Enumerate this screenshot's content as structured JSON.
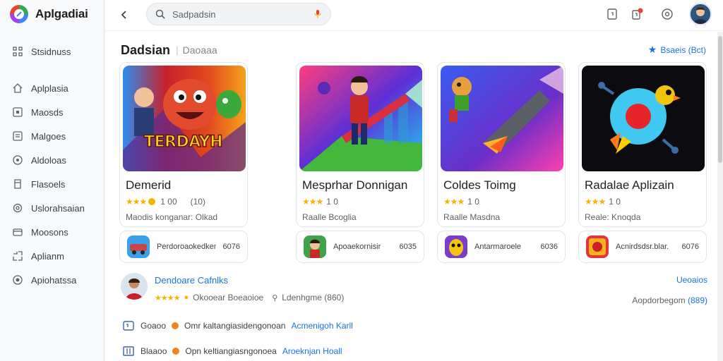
{
  "app": {
    "name": "Aplgadiai"
  },
  "sidebar": {
    "items": [
      {
        "label": "Stsidnuss",
        "icon": "grid-icon"
      },
      {
        "label": "Aplplasia",
        "icon": "home-icon"
      },
      {
        "label": "Maosds",
        "icon": "square-icon"
      },
      {
        "label": "Malgoes",
        "icon": "list-icon"
      },
      {
        "label": "Aldoloas",
        "icon": "badge-icon"
      },
      {
        "label": "Flasoels",
        "icon": "tag-icon"
      },
      {
        "label": "Uslorahsaian",
        "icon": "settings-icon"
      },
      {
        "label": "Moosons",
        "icon": "card-icon"
      },
      {
        "label": "Aplianm",
        "icon": "apps-icon"
      },
      {
        "label": "Apiohatssa",
        "icon": "info-icon"
      }
    ]
  },
  "header": {
    "search_placeholder": "Sadpadsin"
  },
  "main": {
    "title": "Dadsian",
    "subtitle": "Daoaaa",
    "rated_link": "Bsaeis (Bct)",
    "cards": [
      {
        "name": "Demerid",
        "rating": "1 00",
        "reviews": "(10)",
        "sub": "Maodis konganar: Olkad",
        "art_text": "TERDAYH"
      },
      {
        "name": "Mesprhar Donnigan",
        "rating": "1 0",
        "reviews": "",
        "sub": "Raalle Bcoglia"
      },
      {
        "name": "Coldes Toimg",
        "rating": "1 0",
        "reviews": "",
        "sub": "Raalle Masdna"
      },
      {
        "name": "Radalae Aplizain",
        "rating": "1 0",
        "reviews": "",
        "sub": "Reale: Knoqda"
      }
    ],
    "minis": [
      {
        "text": "Perdoroaokedkeniale.",
        "price": "6076"
      },
      {
        "text": "Apoaekornisir",
        "price": "6035"
      },
      {
        "text": "Antarmaroele",
        "price": "6036"
      },
      {
        "text": "Acnirdsdsr.blar.",
        "price": "6076"
      }
    ],
    "developer": {
      "name": "Dendoare Cafnlks",
      "see_all": "Ueoaios",
      "meta_a": "Okooear Boeaoioe",
      "meta_b": "Ldenhgme (860)",
      "count_label": "Aopdorbegom",
      "count_value": "(889)"
    },
    "rows": [
      {
        "label": "Goaoo",
        "text": "Omr kaltangiasidengonoan",
        "link": "Acmenigoh Karll"
      },
      {
        "label": "Blaaoo",
        "text": "Opn keltiangiasngonoea",
        "link": "Aroeknjan Hoall"
      }
    ]
  },
  "colors": {
    "accent": "#1a73e8",
    "star": "#f4b400"
  }
}
